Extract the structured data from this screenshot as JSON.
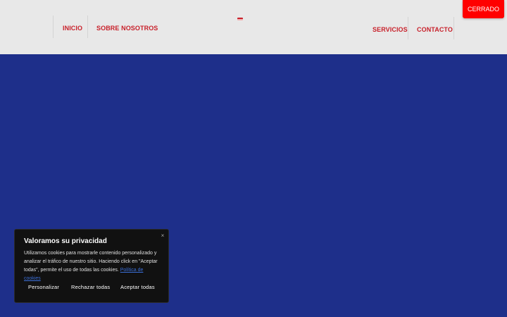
{
  "nav": {
    "items": [
      {
        "label": "INICIO"
      },
      {
        "label": "SOBRE NOSOTROS"
      },
      {
        "label": "SERVICIOS"
      },
      {
        "label": "CONTACTO"
      }
    ]
  },
  "status": {
    "label": "CERRADO"
  },
  "cookie_banner": {
    "title": "Valoramos su privacidad",
    "text_before_link": "Utilizamos cookies para mostrarle contenido personalizado y analizar el tráfico de nuestro sitio. Haciendo click en \"Aceptar todas\", permite el uso de todas las cookies. ",
    "link_label": "Política de cookies",
    "close_icon": "×",
    "buttons": {
      "customize": "Personalizar",
      "reject": "Rechazar todas",
      "accept": "Aceptar todas"
    }
  },
  "colors": {
    "header_bg": "#e8e8e8",
    "nav_text": "#c8202a",
    "hero_bg": "#1e2f8a",
    "status_bg": "#ff0000",
    "cookie_bg": "#111111",
    "cookie_link": "#3b6fd8"
  }
}
